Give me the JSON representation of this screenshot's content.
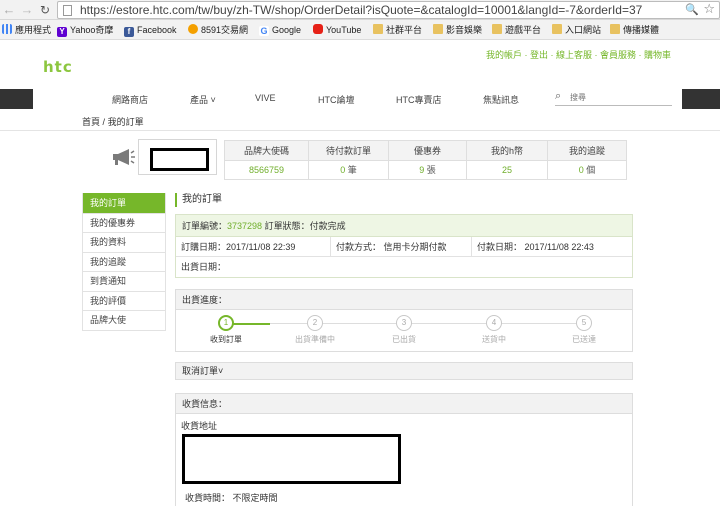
{
  "browser": {
    "url": "https://estore.htc.com/tw/buy/zh-TW/shop/OrderDetail?isQuote=&catalogId=10001&langId=-7&orderId=37",
    "bookmarks": [
      {
        "label": "應用程式",
        "icon": "apps-icon"
      },
      {
        "label": "Yahoo奇摩",
        "icon": "yahoo-icon"
      },
      {
        "label": "Facebook",
        "icon": "facebook-icon"
      },
      {
        "label": "8591交易網",
        "icon": "8591-icon"
      },
      {
        "label": "Google",
        "icon": "google-icon"
      },
      {
        "label": "YouTube",
        "icon": "youtube-icon"
      },
      {
        "label": "社群平台",
        "icon": "folder-icon"
      },
      {
        "label": "影音娛樂",
        "icon": "folder-icon"
      },
      {
        "label": "遊戲平台",
        "icon": "folder-icon"
      },
      {
        "label": "入口網站",
        "icon": "folder-icon"
      },
      {
        "label": "傳播媒體",
        "icon": "folder-icon"
      }
    ]
  },
  "header": {
    "logo": "htc",
    "top_links": "我的帳戶 · 登出 · 線上客服 · 會員服務 · 購物車",
    "nav": [
      "網路商店",
      "產品",
      "VIVE",
      "HTC論壇",
      "HTC專賣店",
      "焦點訊息"
    ],
    "search_placeholder": "搜尋"
  },
  "breadcrumb": {
    "home": "首頁",
    "separator": "/",
    "current": "我的訂單"
  },
  "stats": [
    {
      "label": "品牌大使碼",
      "value": "8566759",
      "unit": ""
    },
    {
      "label": "待付款訂單",
      "value": "0",
      "unit": "筆"
    },
    {
      "label": "優惠券",
      "value": "9",
      "unit": "張"
    },
    {
      "label": "我的h幣",
      "value": "25",
      "unit": ""
    },
    {
      "label": "我的追蹤",
      "value": "0",
      "unit": "個"
    }
  ],
  "side_menu": [
    "我的訂單",
    "我的優惠券",
    "我的資料",
    "我的追蹤",
    "到貨通知",
    "我的評價",
    "品牌大使"
  ],
  "content": {
    "title": "我的訂單",
    "order_no_label": "訂單編號：",
    "order_no": "3737298",
    "status_label": "訂單狀態：",
    "status": "付款完成",
    "order_date": "訂購日期：2017/11/08 22:39",
    "pay_method": "付款方式：  信用卡分期付款",
    "pay_date": "付款日期：  2017/11/08 22:43",
    "ship_date": "出貨日期：",
    "progress_title": "出貨進度：",
    "steps": [
      {
        "num": "1",
        "label": "收到訂單"
      },
      {
        "num": "2",
        "label": "出貨準備中"
      },
      {
        "num": "3",
        "label": "已出貨"
      },
      {
        "num": "4",
        "label": "送貨中"
      },
      {
        "num": "5",
        "label": "已送達"
      }
    ],
    "cancel": "取消訂單",
    "shipping_title": "收貨信息：",
    "address_label": "收貨地址",
    "delivery_time": "收貨時間：  不限定時間"
  },
  "colors": {
    "accent": "#76b72a",
    "nav_dark": "#333333"
  }
}
